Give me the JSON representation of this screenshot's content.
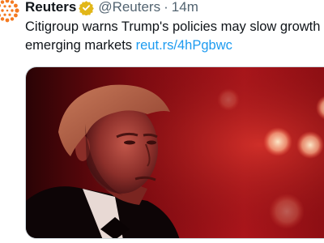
{
  "tweet": {
    "author_name": "Reuters",
    "verified_icon": "verified-badge-icon",
    "handle": "@Reuters",
    "separator": "·",
    "time": "14m",
    "text_line1": "Citigroup warns Trump's policies may slow growth",
    "text_line2_prefix": "emerging markets ",
    "link": "reut.rs/4hPgbwc",
    "media_icon": "news-photo-image"
  },
  "colors": {
    "link": "#1d9bf0",
    "verified_gold": "#e2b719",
    "muted": "#536471",
    "text": "#0f1419"
  }
}
